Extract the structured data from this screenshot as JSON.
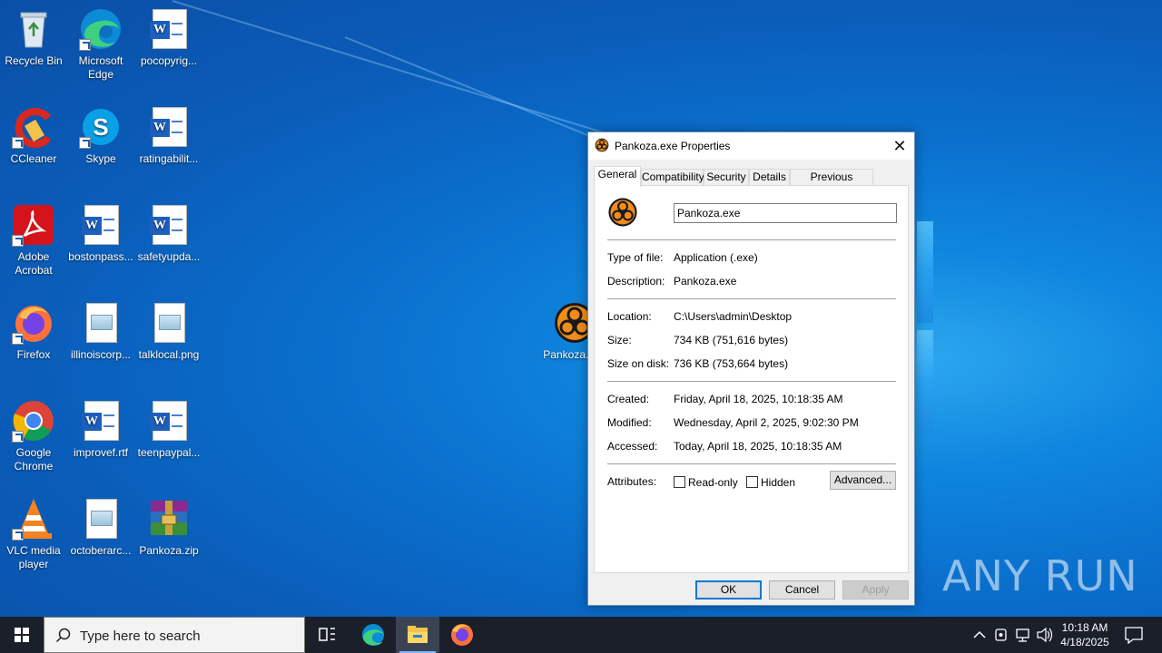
{
  "desktop": {
    "icons": [
      {
        "label": "Recycle Bin",
        "icon": "recycle-bin-icon"
      },
      {
        "label": "Microsoft Edge",
        "icon": "edge-icon"
      },
      {
        "label": "pocopyrig...",
        "icon": "word-document-icon"
      },
      {
        "label": "CCleaner",
        "icon": "ccleaner-icon"
      },
      {
        "label": "Skype",
        "icon": "skype-icon"
      },
      {
        "label": "ratingabilit...",
        "icon": "word-document-icon"
      },
      {
        "label": "Adobe Acrobat",
        "icon": "acrobat-icon"
      },
      {
        "label": "bostonpass...",
        "icon": "word-document-icon"
      },
      {
        "label": "safetyupda...",
        "icon": "word-document-icon"
      },
      {
        "label": "Firefox",
        "icon": "firefox-icon"
      },
      {
        "label": "illinoiscorp...",
        "icon": "image-file-icon"
      },
      {
        "label": "talklocal.png",
        "icon": "image-file-icon"
      },
      {
        "label": "Google Chrome",
        "icon": "chrome-icon"
      },
      {
        "label": "improvef.rtf",
        "icon": "word-document-icon"
      },
      {
        "label": "teenpaypal...",
        "icon": "word-document-icon"
      },
      {
        "label": "VLC media player",
        "icon": "vlc-icon"
      },
      {
        "label": "octoberarc...",
        "icon": "image-file-icon"
      },
      {
        "label": "Pankoza.zip",
        "icon": "winrar-archive-icon"
      },
      {
        "label": "Pankoza.exe",
        "icon": "biohazard-icon"
      }
    ]
  },
  "dialog": {
    "title": "Pankoza.exe Properties",
    "close_label": "✕",
    "tabs": [
      "General",
      "Compatibility",
      "Security",
      "Details",
      "Previous Versions"
    ],
    "active_tab": "General",
    "file_name": "Pankoza.exe",
    "fields": [
      {
        "label": "Type of file:",
        "value": "Application (.exe)"
      },
      {
        "label": "Description:",
        "value": "Pankoza.exe"
      },
      {
        "label": "Location:",
        "value": "C:\\Users\\admin\\Desktop"
      },
      {
        "label": "Size:",
        "value": "734 KB (751,616 bytes)"
      },
      {
        "label": "Size on disk:",
        "value": "736 KB (753,664 bytes)"
      },
      {
        "label": "Created:",
        "value": "Friday, April 18, 2025, 10:18:35 AM"
      },
      {
        "label": "Modified:",
        "value": "Wednesday, April 2, 2025, 9:02:30 PM"
      },
      {
        "label": "Accessed:",
        "value": "Today, April 18, 2025, 10:18:35 AM"
      }
    ],
    "attributes_label": "Attributes:",
    "readonly_label": "Read-only",
    "readonly_checked": false,
    "hidden_label": "Hidden",
    "hidden_checked": false,
    "advanced_label": "Advanced...",
    "ok_label": "OK",
    "cancel_label": "Cancel",
    "apply_label": "Apply"
  },
  "watermark": "ANY RUN",
  "taskbar": {
    "search_placeholder": "Type here to search",
    "time": "10:18 AM",
    "date": "4/18/2025"
  },
  "colors": {
    "accent": "#0078d7",
    "taskbar": "#1b1f2a",
    "desktop": "#0a6fcc"
  }
}
